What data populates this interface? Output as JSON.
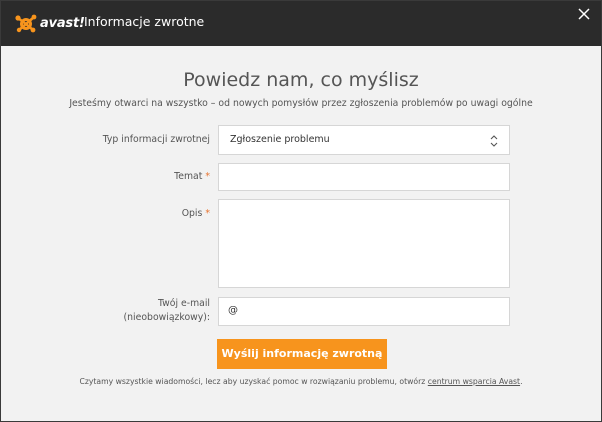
{
  "window": {
    "logo_text": "avast!",
    "title": "Informacje zwrotne",
    "close_icon": "close-icon"
  },
  "heading": "Powiedz nam, co myślisz",
  "subheading": "Jesteśmy otwarci na wszystko – od nowych pomysłów przez zgłoszenia problemów po uwagi ogólne",
  "form": {
    "type": {
      "label": "Typ informacji zwrotnej",
      "value": "Zgłoszenie problemu"
    },
    "subject": {
      "label": "Temat",
      "required_mark": "*",
      "value": ""
    },
    "description": {
      "label": "Opis",
      "required_mark": "*",
      "value": ""
    },
    "email": {
      "label_line1": "Twój e-mail",
      "label_line2": "(nieobowiązkowy):",
      "icon": "@",
      "value": ""
    },
    "submit_label": "Wyślij informację zwrotną"
  },
  "footer": {
    "text": "Czytamy wszystkie wiadomości, lecz aby uzyskać pomoc w rozwiązaniu problemu, otwórz ",
    "link": "centrum wsparcia Avast",
    "suffix": "."
  },
  "colors": {
    "accent": "#f7941d",
    "titlebar": "#2b2b2b",
    "required": "#e8702a"
  }
}
